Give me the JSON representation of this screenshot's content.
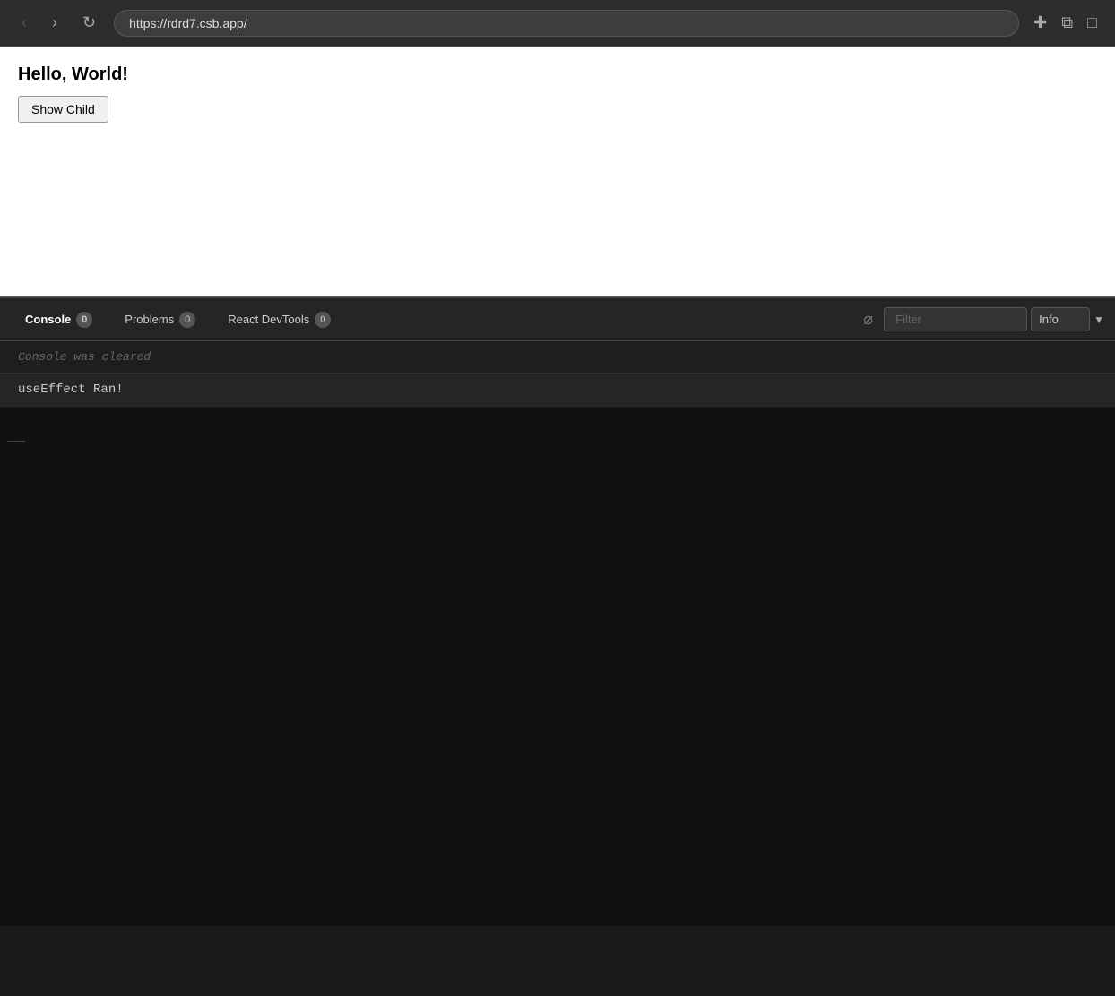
{
  "browser": {
    "url": "https://rdrd7.csb.app/",
    "back_btn": "‹",
    "forward_btn": "›",
    "reload_btn": "↺",
    "icons": [
      "⊕",
      "⧉",
      "⬜"
    ]
  },
  "preview": {
    "title": "Hello, World!",
    "show_child_btn": "Show Child"
  },
  "console": {
    "tabs": [
      {
        "label": "Console",
        "badge": "0",
        "active": true
      },
      {
        "label": "Problems",
        "badge": "0",
        "active": false
      },
      {
        "label": "React DevTools",
        "badge": "0",
        "active": false
      }
    ],
    "filter_placeholder": "Filter",
    "info_option": "Info",
    "cleared_text": "Console was cleared",
    "entries": [
      {
        "text": "useEffect Ran!"
      }
    ]
  }
}
